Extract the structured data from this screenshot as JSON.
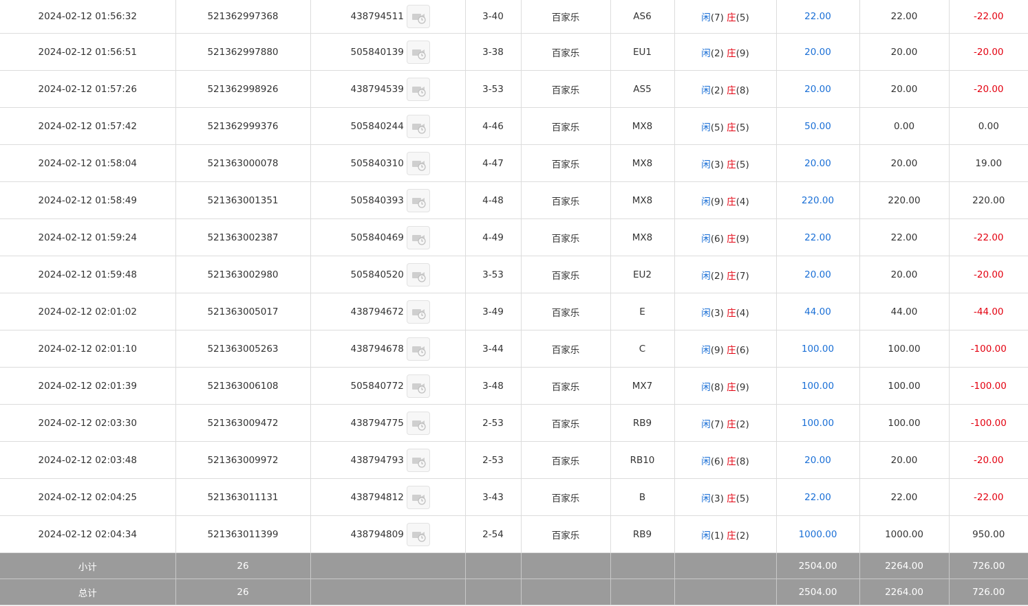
{
  "rows": [
    {
      "time": "2024-02-12 01:56:32",
      "order_no": "521362997368",
      "round_id": "438794511",
      "shoe": "3-40",
      "game": "百家乐",
      "table": "AS6",
      "player_label": "闲",
      "player_pts": "(7)",
      "banker_label": "庄",
      "banker_pts": "(5)",
      "bet": "22.00",
      "valid": "22.00",
      "result": "-22.00",
      "result_color": "red"
    },
    {
      "time": "2024-02-12 01:56:51",
      "order_no": "521362997880",
      "round_id": "505840139",
      "shoe": "3-38",
      "game": "百家乐",
      "table": "EU1",
      "player_label": "闲",
      "player_pts": "(2)",
      "banker_label": "庄",
      "banker_pts": "(9)",
      "bet": "20.00",
      "valid": "20.00",
      "result": "-20.00",
      "result_color": "red"
    },
    {
      "time": "2024-02-12 01:57:26",
      "order_no": "521362998926",
      "round_id": "438794539",
      "shoe": "3-53",
      "game": "百家乐",
      "table": "AS5",
      "player_label": "闲",
      "player_pts": "(2)",
      "banker_label": "庄",
      "banker_pts": "(8)",
      "bet": "20.00",
      "valid": "20.00",
      "result": "-20.00",
      "result_color": "red"
    },
    {
      "time": "2024-02-12 01:57:42",
      "order_no": "521362999376",
      "round_id": "505840244",
      "shoe": "4-46",
      "game": "百家乐",
      "table": "MX8",
      "player_label": "闲",
      "player_pts": "(5)",
      "banker_label": "庄",
      "banker_pts": "(5)",
      "bet": "50.00",
      "valid": "0.00",
      "result": "0.00",
      "result_color": "black"
    },
    {
      "time": "2024-02-12 01:58:04",
      "order_no": "521363000078",
      "round_id": "505840310",
      "shoe": "4-47",
      "game": "百家乐",
      "table": "MX8",
      "player_label": "闲",
      "player_pts": "(3)",
      "banker_label": "庄",
      "banker_pts": "(5)",
      "bet": "20.00",
      "valid": "20.00",
      "result": "19.00",
      "result_color": "black"
    },
    {
      "time": "2024-02-12 01:58:49",
      "order_no": "521363001351",
      "round_id": "505840393",
      "shoe": "4-48",
      "game": "百家乐",
      "table": "MX8",
      "player_label": "闲",
      "player_pts": "(9)",
      "banker_label": "庄",
      "banker_pts": "(4)",
      "bet": "220.00",
      "valid": "220.00",
      "result": "220.00",
      "result_color": "black"
    },
    {
      "time": "2024-02-12 01:59:24",
      "order_no": "521363002387",
      "round_id": "505840469",
      "shoe": "4-49",
      "game": "百家乐",
      "table": "MX8",
      "player_label": "闲",
      "player_pts": "(6)",
      "banker_label": "庄",
      "banker_pts": "(9)",
      "bet": "22.00",
      "valid": "22.00",
      "result": "-22.00",
      "result_color": "red"
    },
    {
      "time": "2024-02-12 01:59:48",
      "order_no": "521363002980",
      "round_id": "505840520",
      "shoe": "3-53",
      "game": "百家乐",
      "table": "EU2",
      "player_label": "闲",
      "player_pts": "(2)",
      "banker_label": "庄",
      "banker_pts": "(7)",
      "bet": "20.00",
      "valid": "20.00",
      "result": "-20.00",
      "result_color": "red"
    },
    {
      "time": "2024-02-12 02:01:02",
      "order_no": "521363005017",
      "round_id": "438794672",
      "shoe": "3-49",
      "game": "百家乐",
      "table": "E",
      "player_label": "闲",
      "player_pts": "(3)",
      "banker_label": "庄",
      "banker_pts": "(4)",
      "bet": "44.00",
      "valid": "44.00",
      "result": "-44.00",
      "result_color": "red"
    },
    {
      "time": "2024-02-12 02:01:10",
      "order_no": "521363005263",
      "round_id": "438794678",
      "shoe": "3-44",
      "game": "百家乐",
      "table": "C",
      "player_label": "闲",
      "player_pts": "(9)",
      "banker_label": "庄",
      "banker_pts": "(6)",
      "bet": "100.00",
      "valid": "100.00",
      "result": "-100.00",
      "result_color": "red"
    },
    {
      "time": "2024-02-12 02:01:39",
      "order_no": "521363006108",
      "round_id": "505840772",
      "shoe": "3-48",
      "game": "百家乐",
      "table": "MX7",
      "player_label": "闲",
      "player_pts": "(8)",
      "banker_label": "庄",
      "banker_pts": "(9)",
      "bet": "100.00",
      "valid": "100.00",
      "result": "-100.00",
      "result_color": "red"
    },
    {
      "time": "2024-02-12 02:03:30",
      "order_no": "521363009472",
      "round_id": "438794775",
      "shoe": "2-53",
      "game": "百家乐",
      "table": "RB9",
      "player_label": "闲",
      "player_pts": "(7)",
      "banker_label": "庄",
      "banker_pts": "(2)",
      "bet": "100.00",
      "valid": "100.00",
      "result": "-100.00",
      "result_color": "red"
    },
    {
      "time": "2024-02-12 02:03:48",
      "order_no": "521363009972",
      "round_id": "438794793",
      "shoe": "2-53",
      "game": "百家乐",
      "table": "RB10",
      "player_label": "闲",
      "player_pts": "(6)",
      "banker_label": "庄",
      "banker_pts": "(8)",
      "bet": "20.00",
      "valid": "20.00",
      "result": "-20.00",
      "result_color": "red"
    },
    {
      "time": "2024-02-12 02:04:25",
      "order_no": "521363011131",
      "round_id": "438794812",
      "shoe": "3-43",
      "game": "百家乐",
      "table": "B",
      "player_label": "闲",
      "player_pts": "(3)",
      "banker_label": "庄",
      "banker_pts": "(5)",
      "bet": "22.00",
      "valid": "22.00",
      "result": "-22.00",
      "result_color": "red"
    },
    {
      "time": "2024-02-12 02:04:34",
      "order_no": "521363011399",
      "round_id": "438794809",
      "shoe": "2-54",
      "game": "百家乐",
      "table": "RB9",
      "player_label": "闲",
      "player_pts": "(1)",
      "banker_label": "庄",
      "banker_pts": "(2)",
      "bet": "1000.00",
      "valid": "1000.00",
      "result": "950.00",
      "result_color": "black"
    }
  ],
  "subtotal": {
    "label": "小计",
    "count": "26",
    "bet": "2504.00",
    "valid": "2264.00",
    "result": "726.00"
  },
  "total": {
    "label": "总计",
    "count": "26",
    "bet": "2504.00",
    "valid": "2264.00",
    "result": "726.00"
  },
  "icons": {
    "replay": "video-replay-icon"
  },
  "colors": {
    "blue": "#1a6fd6",
    "red": "#e3000f",
    "summary_bg": "#9b9b9b"
  }
}
